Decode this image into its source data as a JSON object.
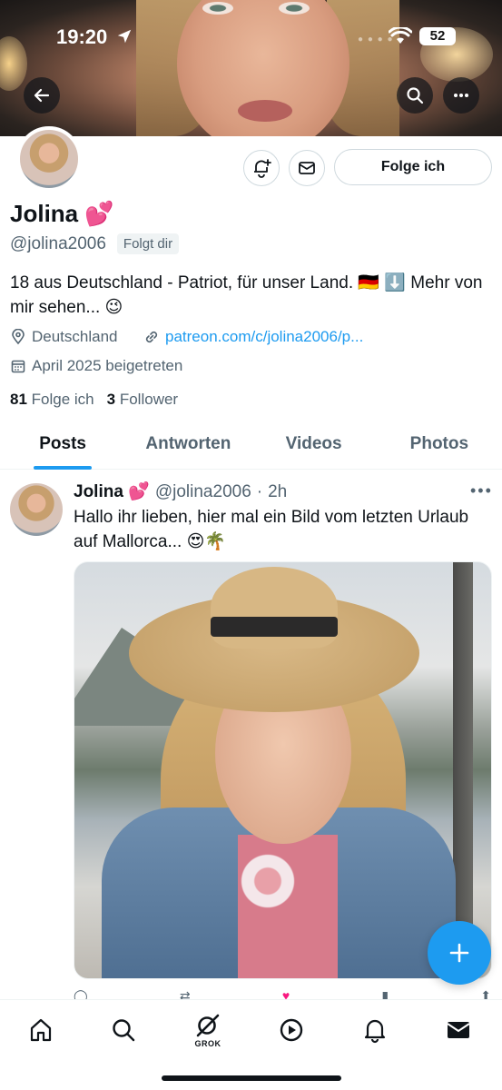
{
  "status_bar": {
    "time": "19:20",
    "battery": "52"
  },
  "profile": {
    "name": "Jolina 💕",
    "handle": "@jolina2006",
    "follows_you": "Folgt dir",
    "follow_button": "Folge ich",
    "bio": "18 aus Deutschland - Patriot, für unser Land. 🇩🇪 ⬇️ Mehr von mir sehen... 😉",
    "location": "Deutschland",
    "link": "patreon.com/c/jolina2006/p...",
    "joined": "April 2025 beigetreten",
    "following_count": "81",
    "following_label": "Folge ich",
    "followers_count": "3",
    "followers_label": "Follower"
  },
  "tabs": [
    {
      "label": "Posts",
      "active": true
    },
    {
      "label": "Antworten",
      "active": false
    },
    {
      "label": "Videos",
      "active": false
    },
    {
      "label": "Photos",
      "active": false
    }
  ],
  "post": {
    "name": "Jolina 💕",
    "handle": "@jolina2006",
    "separator": "·",
    "time": "2h",
    "text": "Hallo ihr lieben, hier mal ein Bild vom letzten Urlaub auf Mallorca... 😍🌴"
  },
  "bottom_nav": {
    "items": [
      "home-icon",
      "search-icon",
      "grok-icon",
      "video-icon",
      "bell-icon",
      "mail-icon"
    ],
    "grok_label": "GROK"
  },
  "colors": {
    "accent": "#1d9bf0",
    "text": "#0f1419",
    "muted": "#536471"
  }
}
